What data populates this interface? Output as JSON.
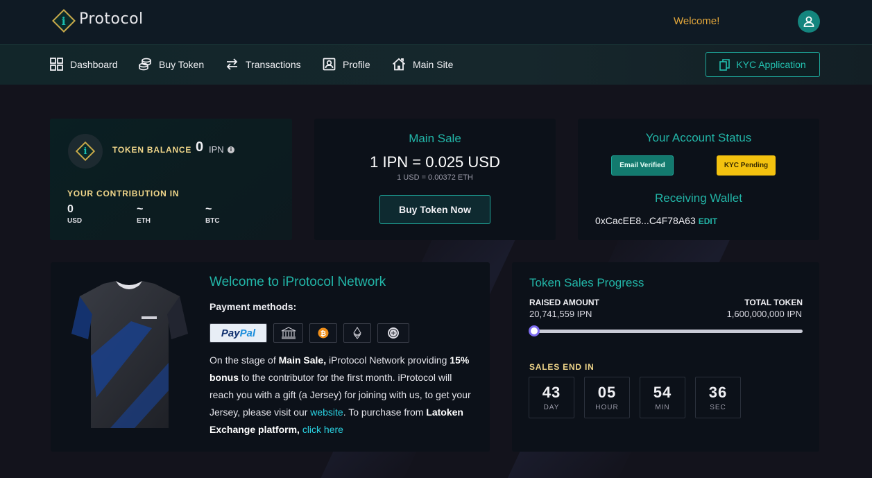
{
  "header": {
    "logo_text": "Protocol",
    "logo_letter": "i",
    "welcome": "Welcome!"
  },
  "nav": {
    "items": [
      {
        "label": "Dashboard",
        "icon": "grid-icon"
      },
      {
        "label": "Buy Token",
        "icon": "coins-icon"
      },
      {
        "label": "Transactions",
        "icon": "arrows-icon"
      },
      {
        "label": "Profile",
        "icon": "profile-icon"
      },
      {
        "label": "Main Site",
        "icon": "home-icon"
      }
    ],
    "kyc_label": "KYC Application"
  },
  "balance": {
    "label": "TOKEN BALANCE",
    "value": "0",
    "unit": "IPN",
    "contribution_label": "YOUR CONTRIBUTION IN",
    "contributions": [
      {
        "value": "0",
        "unit": "USD"
      },
      {
        "value": "~",
        "unit": "ETH"
      },
      {
        "value": "~",
        "unit": "BTC"
      }
    ]
  },
  "main_sale": {
    "title": "Main Sale",
    "rate": "1 IPN = 0.025 USD",
    "sub_rate": "1 USD = 0.00372 ETH",
    "buy_label": "Buy Token Now"
  },
  "account": {
    "title": "Your Account Status",
    "email_badge": "Email Verified",
    "kyc_badge": "KYC Pending",
    "wallet_title": "Receiving Wallet",
    "wallet": "0xCacEE8...C4F78A63",
    "edit_label": "EDIT"
  },
  "welcome_card": {
    "title": "Welcome to iProtocol Network",
    "payment_label": "Payment methods:",
    "paypal_a": "Pay",
    "paypal_b": "Pal",
    "t1": "On the stage of ",
    "b1": "Main Sale,",
    "t2": " iProtocol Network providing ",
    "b2": "15% bonus",
    "t3": " to the contributor for the first month. iProtocol will reach you with a gift (a Jersey) for joining with us, to get your Jersey, please visit our ",
    "link1": "website",
    "t4": ". To purchase from ",
    "b3": "Latoken Exchange platform,",
    "t5": " ",
    "link2": "click here"
  },
  "progress": {
    "title": "Token Sales Progress",
    "raised_label": "RAISED AMOUNT",
    "raised_value": "20,741,559 IPN",
    "total_label": "TOTAL TOKEN",
    "total_value": "1,600,000,000 IPN",
    "fraction": 0.013,
    "ends_label": "SALES END IN",
    "countdown": [
      {
        "value": "43",
        "label": "DAY"
      },
      {
        "value": "05",
        "label": "HOUR"
      },
      {
        "value": "54",
        "label": "MIN"
      },
      {
        "value": "36",
        "label": "SEC"
      }
    ]
  },
  "colors": {
    "accent": "#22b6a8",
    "gold": "#f0d68a",
    "welcome": "#e4a83b",
    "pending": "#f4c20f",
    "progress": "#7d6cf0"
  }
}
